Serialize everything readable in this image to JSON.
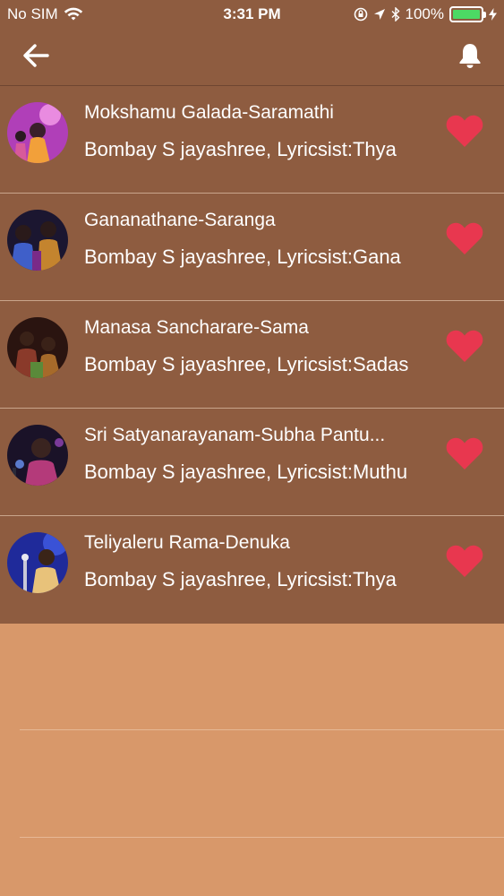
{
  "status_bar": {
    "carrier": "No SIM",
    "time": "3:31 PM",
    "battery_percent": "100%"
  },
  "nav": {
    "back_icon": "arrow-left-icon",
    "notifications_icon": "bell-icon"
  },
  "songs": [
    {
      "title": "Mokshamu Galada-Saramathi",
      "subtitle": "Bombay S jayashree, Lyricsist:Thya",
      "favorite": true
    },
    {
      "title": "Gananathane-Saranga",
      "subtitle": "Bombay S jayashree, Lyricsist:Gana",
      "favorite": true
    },
    {
      "title": "Manasa Sancharare-Sama",
      "subtitle": "Bombay S jayashree, Lyricsist:Sadas",
      "favorite": true
    },
    {
      "title": "Sri Satyanarayanam-Subha Pantu...",
      "subtitle": "Bombay S jayashree, Lyricsist:Muthu",
      "favorite": true
    },
    {
      "title": "Teliyaleru Rama-Denuka",
      "subtitle": "Bombay S jayashree, Lyricsist:Thya",
      "favorite": true
    }
  ],
  "colors": {
    "header_bg": "#8e5c40",
    "row_bg": "#8e5c40",
    "page_bg": "#d8986a",
    "heart": "#e8374f"
  }
}
